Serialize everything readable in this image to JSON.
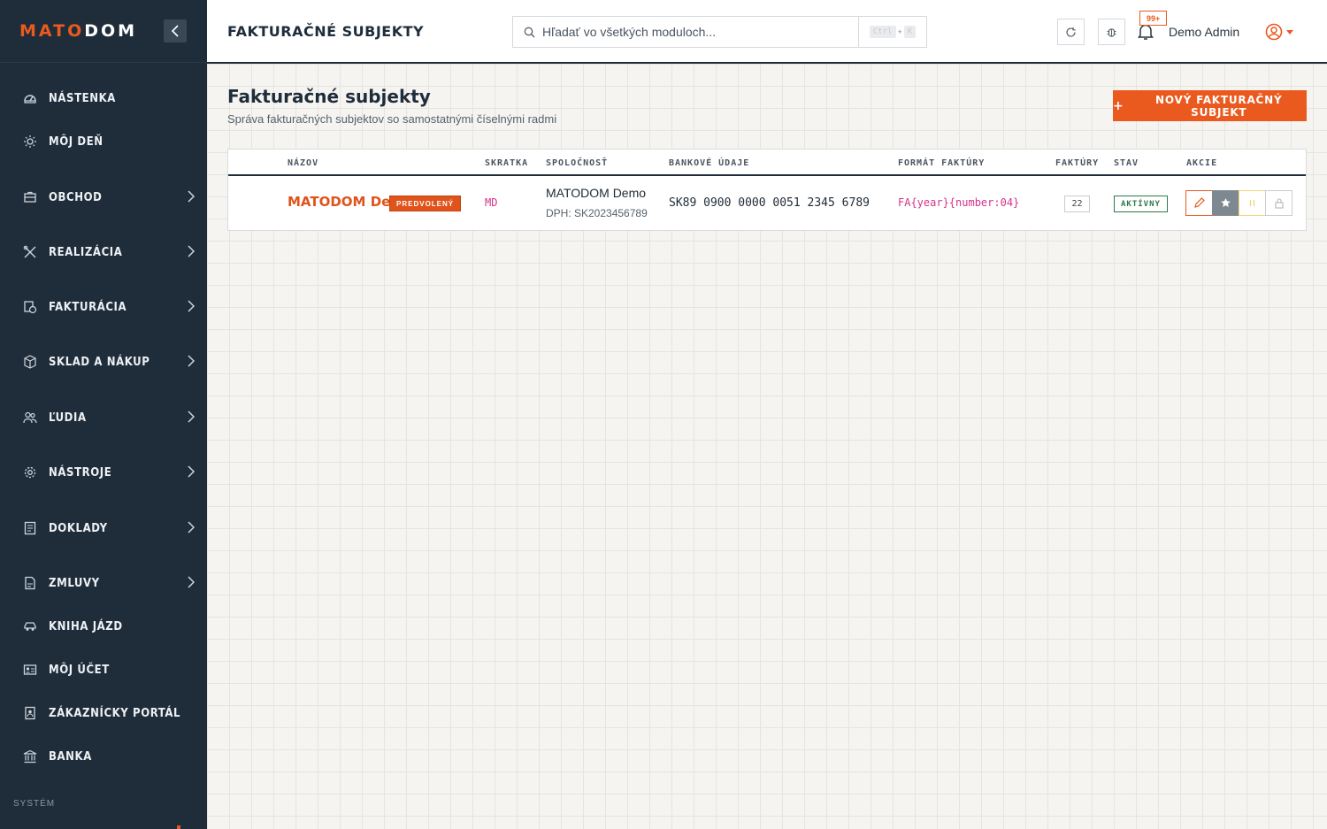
{
  "app": {
    "logo_part1": "MATO",
    "logo_part2": "DOM"
  },
  "sidebar": {
    "items": [
      {
        "label": "Nástenka",
        "icon": "dashboard-icon"
      },
      {
        "label": "Môj deň",
        "icon": "sun-icon"
      },
      {
        "label": "Obchod",
        "icon": "briefcase-icon"
      },
      {
        "label": "Realizácia",
        "icon": "tools-icon"
      },
      {
        "label": "Fakturácia",
        "icon": "invoice-icon"
      },
      {
        "label": "Sklad a nákup",
        "icon": "box-icon"
      },
      {
        "label": "Ľudia",
        "icon": "people-icon"
      },
      {
        "label": "Nástroje",
        "icon": "gear-icon"
      },
      {
        "label": "Doklady",
        "icon": "document-icon"
      },
      {
        "label": "Zmluvy",
        "icon": "contract-icon"
      },
      {
        "label": "Kniha jázd",
        "icon": "car-icon"
      },
      {
        "label": "Môj účet",
        "icon": "id-card-icon"
      },
      {
        "label": "Zákaznícky portál",
        "icon": "portal-icon"
      },
      {
        "label": "Banka",
        "icon": "bank-icon"
      }
    ],
    "section_label": "SYSTÉM"
  },
  "header": {
    "title": "Fakturačné subjekty",
    "search_placeholder": "Hľadať vo všetkých moduloch...",
    "shortcut_key1": "Ctrl",
    "shortcut_plus": "+",
    "shortcut_key2": "K",
    "notification_count": "99+",
    "user_name": "Demo Admin"
  },
  "page": {
    "title": "Fakturačné subjekty",
    "subtitle": "Správa fakturačných subjektov so samostatnými číselnými radmi",
    "new_button_icon": "+",
    "new_button_label": "NOVÝ FAKTURAČNÝ SUBJEKT"
  },
  "table": {
    "columns": {
      "name": "Názov",
      "abbr": "Skratka",
      "company": "Spoločnosť",
      "bank": "Bankové údaje",
      "format": "Formát faktúry",
      "invoices": "Faktúry",
      "status": "Stav",
      "actions": "Akcie"
    },
    "rows": [
      {
        "name": "MATODOM Demo",
        "default_badge": "PREDVOLENÝ",
        "abbr": "MD",
        "company": "MATODOM Demo",
        "vat": "DPH: SK2023456789",
        "bank": "SK89 0900 0000 0051 2345 6789",
        "format": "FA{year}{number:04}",
        "invoices": "22",
        "status": "AKTÍVNY"
      }
    ]
  },
  "colors": {
    "accent": "#ea5a1f",
    "sidebar_bg": "#1f2d3b",
    "status_active": "#2d7a4b",
    "mono_highlight": "#d6338a"
  }
}
